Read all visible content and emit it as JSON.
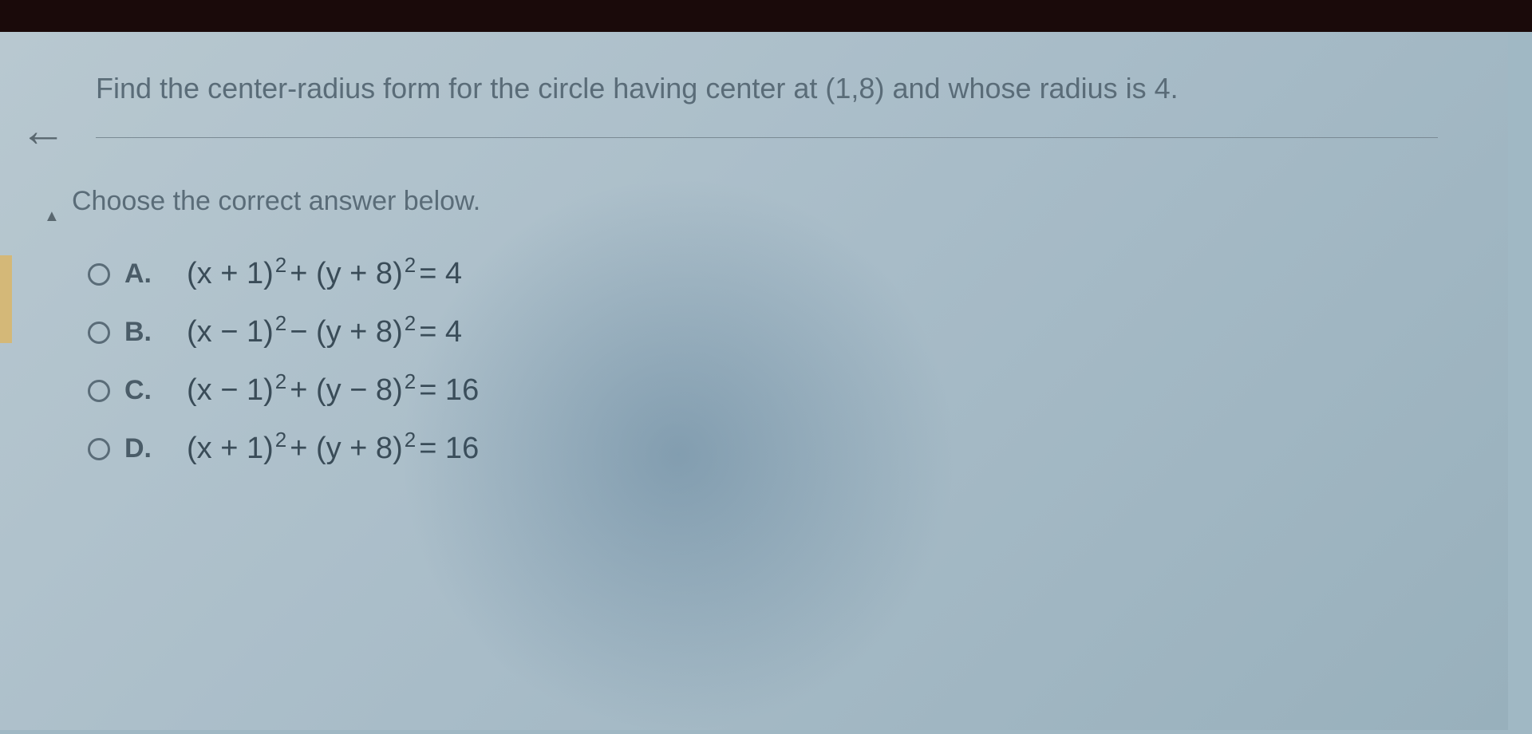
{
  "question": "Find the center-radius form for the circle having center at (1,8) and whose radius is 4.",
  "instruction": "Choose the correct answer below.",
  "options": [
    {
      "label": "A.",
      "equation_parts": {
        "p1": "(x + 1)",
        "e1": "2",
        "p2": " + (y + 8)",
        "e2": "2",
        "p3": " = 4"
      }
    },
    {
      "label": "B.",
      "equation_parts": {
        "p1": "(x − 1)",
        "e1": "2",
        "p2": " − (y + 8)",
        "e2": "2",
        "p3": " = 4"
      }
    },
    {
      "label": "C.",
      "equation_parts": {
        "p1": "(x − 1)",
        "e1": "2",
        "p2": " + (y − 8)",
        "e2": "2",
        "p3": " = 16"
      }
    },
    {
      "label": "D.",
      "equation_parts": {
        "p1": "(x + 1)",
        "e1": "2",
        "p2": " + (y + 8)",
        "e2": "2",
        "p3": " = 16"
      }
    }
  ]
}
